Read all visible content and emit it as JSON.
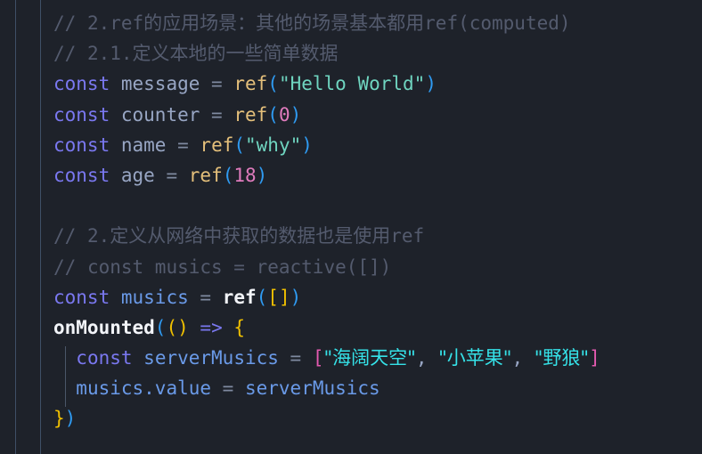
{
  "editor": {
    "title": "code-editor",
    "background_color": "#1e222a",
    "font_size_px": 21,
    "language": "javascript",
    "ruler_color": "#3f5066",
    "indent_guide_color": "#4b5668"
  },
  "theme": {
    "comment": "#545b6e",
    "keyword": "#7a78f0",
    "variable": "#98a6c4",
    "variable_blue": "#6a9ae8",
    "operator": "#7f8aa0",
    "function": "#e5c07b",
    "function_white": "#f2f4f8",
    "string": "#6fd5c0",
    "string_cyan": "#35e2e8",
    "number": "#e07bbd",
    "bracket_blue": "#2f9bf2",
    "bracket_yellow": "#f0c000",
    "bracket_pink": "#e45ab0"
  },
  "code": {
    "lines": [
      {
        "id": 1,
        "text": "// 2.ref的应用场景：其他的场景基本都用ref(computed)",
        "kind": "comment"
      },
      {
        "id": 2,
        "text": "// 2.1.定义本地的一些简单数据",
        "kind": "comment"
      },
      {
        "id": 3,
        "text": "const message = ref(\"Hello World\")",
        "kind": "statement"
      },
      {
        "id": 4,
        "text": "const counter = ref(0)",
        "kind": "statement"
      },
      {
        "id": 5,
        "text": "const name = ref(\"why\")",
        "kind": "statement"
      },
      {
        "id": 6,
        "text": "const age = ref(18)",
        "kind": "statement"
      },
      {
        "id": 7,
        "text": "",
        "kind": "blank"
      },
      {
        "id": 8,
        "text": "// 2.定义从网络中获取的数据也是使用ref",
        "kind": "comment"
      },
      {
        "id": 9,
        "text": "// const musics = reactive([])",
        "kind": "comment"
      },
      {
        "id": 10,
        "text": "const musics = ref([])",
        "kind": "statement"
      },
      {
        "id": 11,
        "text": "onMounted(() => {",
        "kind": "statement"
      },
      {
        "id": 12,
        "text": "  const serverMusics = [\"海阔天空\", \"小苹果\", \"野狼\"]",
        "kind": "statement"
      },
      {
        "id": 13,
        "text": "  musics.value = serverMusics",
        "kind": "statement"
      },
      {
        "id": 14,
        "text": "})",
        "kind": "statement"
      }
    ],
    "tokens": {
      "comment_slashes": "// ",
      "l1_a": "2.ref",
      "l1_b": "的应用场景：其他的场景基本都用",
      "l1_c": "ref(computed)",
      "l2_a": "2.1.",
      "l2_b": "定义本地的一些简单数据",
      "l8_a": "2.",
      "l8_b": "定义从网络中获取的数据也是使用",
      "l8_c": "ref",
      "l9_text": "const musics = reactive([])",
      "kw_const": "const",
      "eq": "=",
      "arrow": "=>",
      "fn_ref": "ref",
      "fn_onmounted": "onMounted",
      "var_message": "message",
      "var_counter": "counter",
      "var_name": "name",
      "var_age": "age",
      "var_musics": "musics",
      "var_servermusics": "serverMusics",
      "var_musics_value": "musics.value",
      "str_hello": "\"Hello World\"",
      "str_why": "\"why\"",
      "num_zero": "0",
      "num_18": "18",
      "paren_open": "(",
      "paren_close": ")",
      "bracket_open": "[",
      "bracket_close": "]",
      "brace_open": "{",
      "brace_close": "}",
      "str_song1": "\"海阔天空\"",
      "str_song2": "\"小苹果\"",
      "str_song3": "\"野狼\"",
      "comma": ", "
    }
  }
}
